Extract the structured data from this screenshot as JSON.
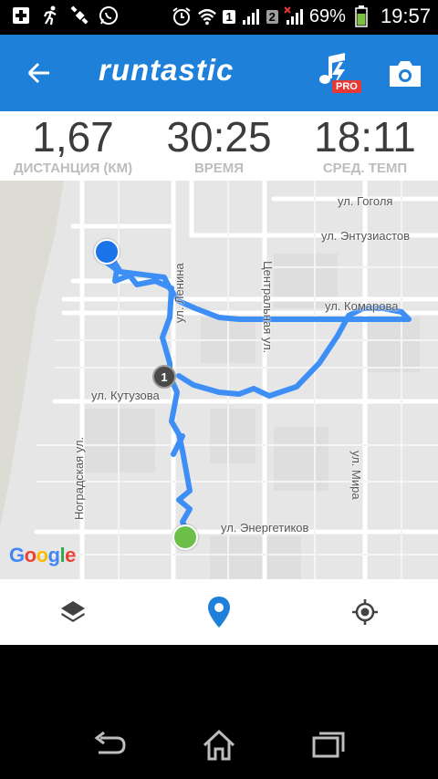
{
  "status_bar": {
    "sim1": "1",
    "sim2": "2",
    "battery": "69%",
    "time": "19:57"
  },
  "app_bar": {
    "logo_text": "runtastic",
    "pro_badge": "PRO"
  },
  "stats": [
    {
      "value": "1,67",
      "label": "ДИСТАНЦИЯ (КМ)"
    },
    {
      "value": "30:25",
      "label": "ВРЕМЯ"
    },
    {
      "value": "18:11",
      "label": "СРЕД. ТЕМП"
    }
  ],
  "map": {
    "streets": {
      "gogolya": "ул. Гоголя",
      "entuziastov": "ул. Энтузиастов",
      "komarova": "ул. Комарова",
      "lenina": "ул. Ленина",
      "centralnaya": "Центральная ул.",
      "kutuzova": "ул. Кутузова",
      "nogradskaya": "Ноградская ул.",
      "mira": "ул. Мира",
      "energetikov": "ул. Энергетиков"
    },
    "km_marker": "1",
    "google_logo": "Google"
  },
  "colors": {
    "accent": "#1e80d8",
    "route": "#3d8ff5",
    "start": "#1a73e8",
    "finish": "#6cc04a",
    "map_bg": "#e6e6e6"
  }
}
